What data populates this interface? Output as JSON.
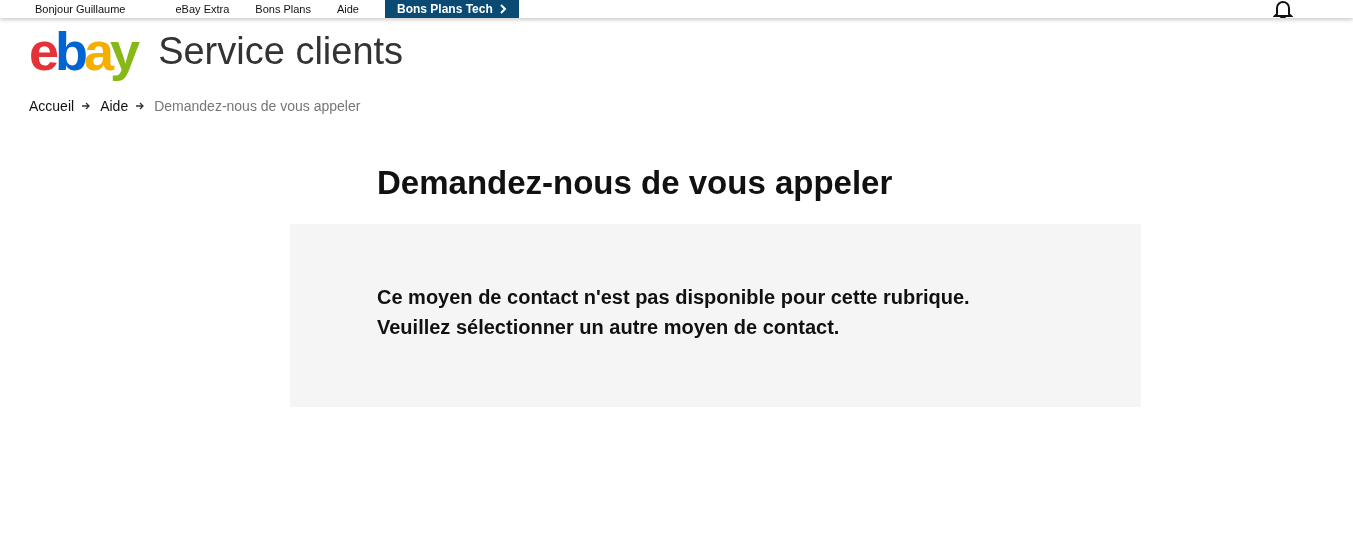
{
  "top_bar": {
    "greeting": "Bonjour Guillaume",
    "links": [
      "eBay Extra",
      "Bons Plans",
      "Aide"
    ],
    "promo_button": "Bons Plans Tech"
  },
  "header": {
    "logo": "ebay",
    "title": "Service clients"
  },
  "breadcrumb": {
    "links": [
      "Accueil",
      "Aide"
    ],
    "current": "Demandez-nous de vous appeler"
  },
  "page_title": "Demandez-nous de vous appeler",
  "notice": {
    "lines": [
      "Ce moyen de contact n'est pas disponible pour cette rubrique.",
      "Veuillez sélectionner un autre moyen de contact."
    ]
  }
}
